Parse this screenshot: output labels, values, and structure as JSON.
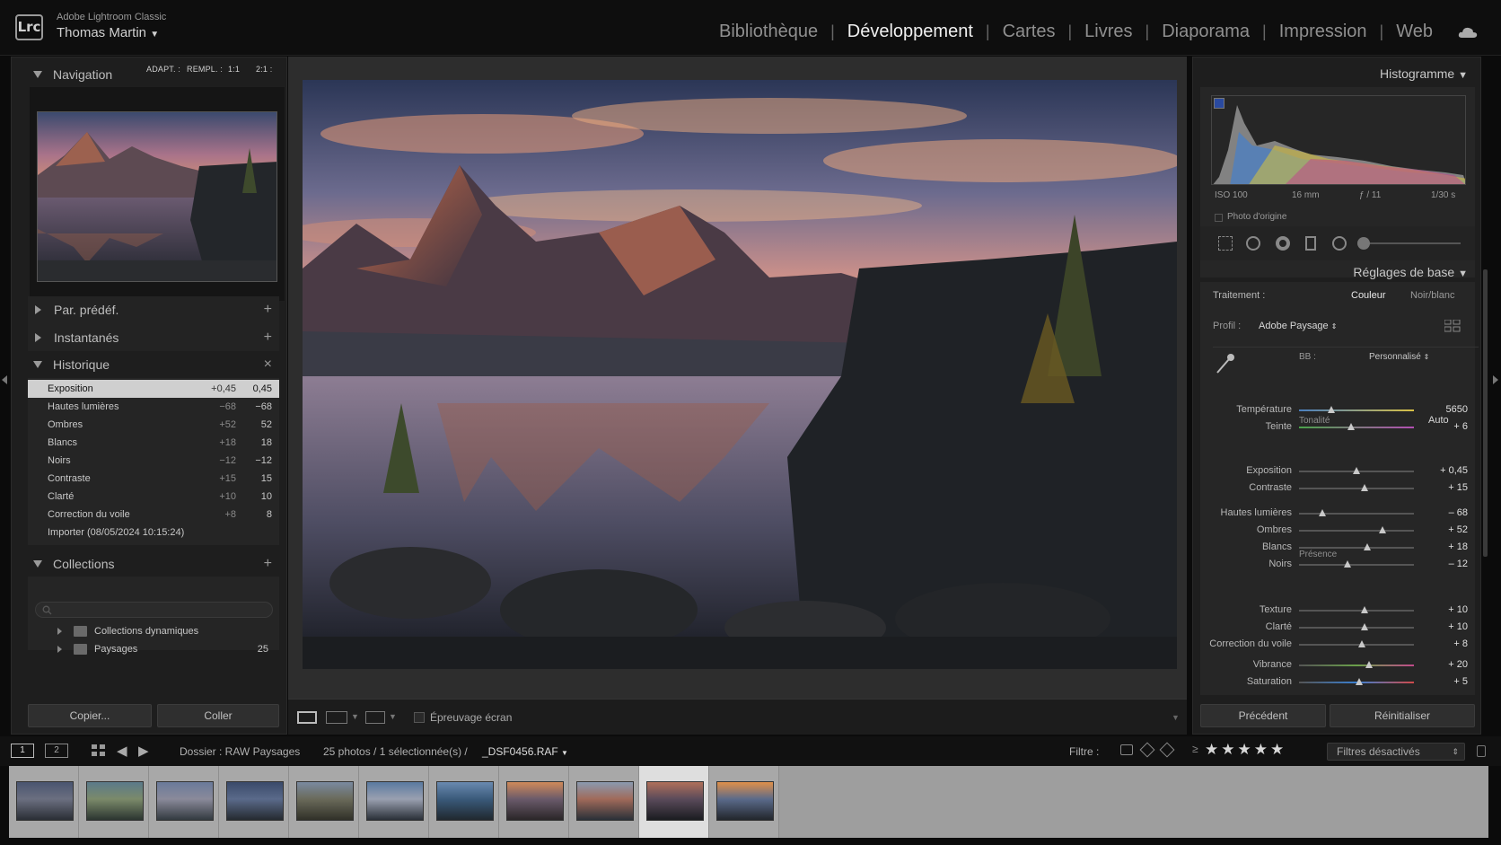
{
  "app": {
    "product": "Adobe Lightroom Classic",
    "logo": "Lrc",
    "user": "Thomas Martin"
  },
  "modules": [
    "Bibliothèque",
    "Développement",
    "Cartes",
    "Livres",
    "Diaporama",
    "Impression",
    "Web"
  ],
  "active_module": "Développement",
  "left": {
    "navigation": {
      "title": "Navigation",
      "zoom": [
        "ADAPT. :",
        "REMPL. :",
        "1:1",
        "2:1 :"
      ]
    },
    "presets": {
      "title": "Par. prédéf.",
      "add": "+"
    },
    "snapshots": {
      "title": "Instantanés",
      "add": "+"
    },
    "history": {
      "title": "Historique",
      "clear": "×",
      "items": [
        {
          "label": "Exposition",
          "delta": "+0,45",
          "value": "0,45"
        },
        {
          "label": "Hautes lumières",
          "delta": "−68",
          "value": "−68"
        },
        {
          "label": "Ombres",
          "delta": "+52",
          "value": "52"
        },
        {
          "label": "Blancs",
          "delta": "+18",
          "value": "18"
        },
        {
          "label": "Noirs",
          "delta": "−12",
          "value": "−12"
        },
        {
          "label": "Contraste",
          "delta": "+15",
          "value": "15"
        },
        {
          "label": "Clarté",
          "delta": "+10",
          "value": "10"
        },
        {
          "label": "Correction du voile",
          "delta": "+8",
          "value": "8"
        },
        {
          "label": "Importer (08/05/2024 10:15:24)",
          "delta": "",
          "value": ""
        }
      ]
    },
    "collections": {
      "title": "Collections",
      "add": "+",
      "items": [
        {
          "name": "Collections dynamiques",
          "count": ""
        },
        {
          "name": "Paysages",
          "count": "25"
        }
      ]
    },
    "copy_button": "Copier...",
    "paste_button": "Coller"
  },
  "toolbar": {
    "softproof_label": "Épreuvage écran"
  },
  "right": {
    "histogram": {
      "title": "Histogramme",
      "iso": "ISO 100",
      "focal": "16 mm",
      "aperture": "ƒ / 11",
      "shutter": "1/30 s",
      "original_photo": "Photo d'origine"
    },
    "basic": {
      "title": "Réglages de base",
      "treatment_label": "Traitement :",
      "color": "Couleur",
      "bw": "Noir/blanc",
      "profile_label": "Profil :",
      "profile_value": "Adobe Paysage",
      "wb_label": "BB :",
      "wb_value": "Personnalisé",
      "tone_title": "Tonalité",
      "auto": "Auto",
      "presence_title": "Présence",
      "sliders": [
        {
          "label": "Température",
          "value": "5650",
          "pos": 0.28
        },
        {
          "label": "Teinte",
          "value": "+ 6",
          "pos": 0.45
        },
        {
          "label": "Exposition",
          "value": "+ 0,45",
          "pos": 0.5
        },
        {
          "label": "Contraste",
          "value": "+ 15",
          "pos": 0.57
        },
        {
          "label": "Hautes lumières",
          "value": "– 68",
          "pos": 0.2
        },
        {
          "label": "Ombres",
          "value": "+ 52",
          "pos": 0.73
        },
        {
          "label": "Blancs",
          "value": "+ 18",
          "pos": 0.59
        },
        {
          "label": "Noirs",
          "value": "– 12",
          "pos": 0.42
        },
        {
          "label": "Texture",
          "value": "+ 10",
          "pos": 0.57
        },
        {
          "label": "Clarté",
          "value": "+ 10",
          "pos": 0.57
        },
        {
          "label": "Correction du voile",
          "value": "+ 8",
          "pos": 0.55
        },
        {
          "label": "Vibrance",
          "value": "+ 20",
          "pos": 0.61
        },
        {
          "label": "Saturation",
          "value": "+ 5",
          "pos": 0.52
        }
      ]
    },
    "previous_button": "Précédent",
    "reset_button": "Réinitialiser"
  },
  "filmstrip_bar": {
    "page1": "1",
    "page2": "2",
    "folder": "Dossier : RAW Paysages",
    "count": "25 photos / 1 sélectionnée(s) /",
    "filename": "_DSF0456.RAF",
    "filter_label": "Filtre :",
    "filters_off": "Filtres désactivés",
    "rating": 5
  },
  "filmstrip": {
    "thumb_count": 11,
    "selected_index": 9
  },
  "colors": {
    "accent": "#cfcfcf",
    "panel": "#1e1e1e",
    "center": "#2d2d2d"
  }
}
